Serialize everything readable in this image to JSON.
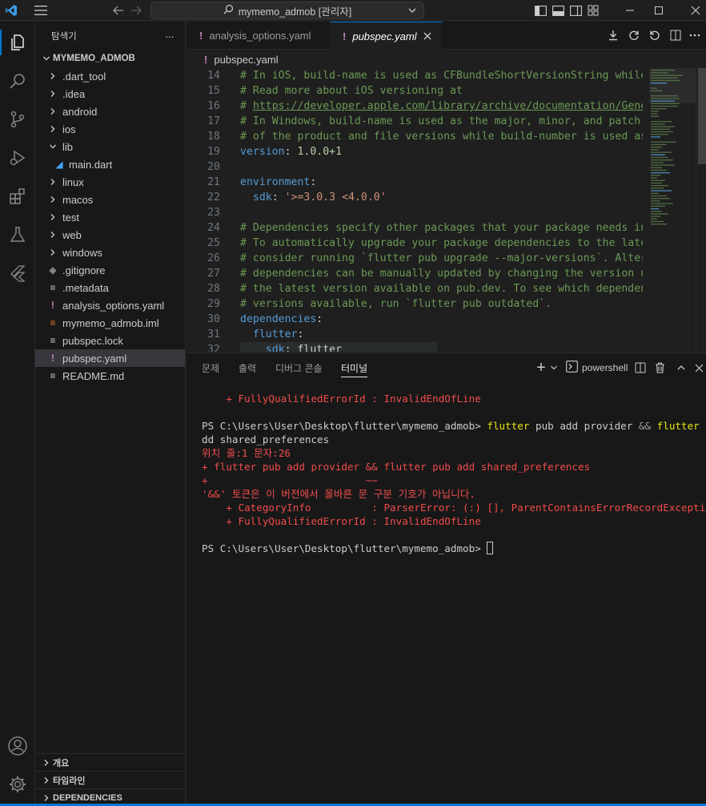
{
  "titlebar": {
    "search_label": "mymemo_admob [관리자]"
  },
  "explorer": {
    "title": "탐색기",
    "more": "···",
    "root": "MYMEMO_ADMOB",
    "items": [
      {
        "label": ".dart_tool",
        "type": "folder"
      },
      {
        "label": ".idea",
        "type": "folder"
      },
      {
        "label": "android",
        "type": "folder"
      },
      {
        "label": "ios",
        "type": "folder"
      },
      {
        "label": "lib",
        "type": "folder-open"
      },
      {
        "label": "main.dart",
        "type": "dart"
      },
      {
        "label": "linux",
        "type": "folder"
      },
      {
        "label": "macos",
        "type": "folder"
      },
      {
        "label": "test",
        "type": "folder"
      },
      {
        "label": "web",
        "type": "folder"
      },
      {
        "label": "windows",
        "type": "folder"
      },
      {
        "label": ".gitignore",
        "type": "git"
      },
      {
        "label": ".metadata",
        "type": "text"
      },
      {
        "label": "analysis_options.yaml",
        "type": "yaml"
      },
      {
        "label": "mymemo_admob.iml",
        "type": "iml"
      },
      {
        "label": "pubspec.lock",
        "type": "text"
      },
      {
        "label": "pubspec.yaml",
        "type": "yaml",
        "selected": true
      },
      {
        "label": "README.md",
        "type": "text"
      }
    ],
    "bottom_panels": [
      "개요",
      "타임라인",
      "DEPENDENCIES"
    ]
  },
  "tabs": [
    {
      "label": "analysis_options.yaml",
      "active": false
    },
    {
      "label": "pubspec.yaml",
      "active": true
    }
  ],
  "breadcrumb": "pubspec.yaml",
  "code_lines": [
    {
      "n": "14",
      "parts": [
        {
          "c": "com",
          "t": "# In iOS, build-name is used as CFBundleShortVersionString while b"
        }
      ]
    },
    {
      "n": "15",
      "parts": [
        {
          "c": "com",
          "t": "# Read more about iOS versioning at"
        }
      ]
    },
    {
      "n": "16",
      "parts": [
        {
          "c": "com",
          "t": "# "
        },
        {
          "c": "link",
          "t": "https://developer.apple.com/library/archive/documentation/Genera"
        }
      ]
    },
    {
      "n": "17",
      "parts": [
        {
          "c": "com",
          "t": "# In Windows, build-name is used as the major, minor, and patch pa"
        }
      ]
    },
    {
      "n": "18",
      "parts": [
        {
          "c": "com",
          "t": "# of the product and file versions while build-number is used as t"
        }
      ]
    },
    {
      "n": "19",
      "parts": [
        {
          "c": "key",
          "t": "version"
        },
        {
          "c": "plain",
          "t": ": "
        },
        {
          "c": "num",
          "t": "1.0.0+1"
        }
      ]
    },
    {
      "n": "20",
      "parts": []
    },
    {
      "n": "21",
      "parts": [
        {
          "c": "key",
          "t": "environment"
        },
        {
          "c": "plain",
          "t": ":"
        }
      ]
    },
    {
      "n": "22",
      "parts": [
        {
          "c": "plain",
          "t": "  "
        },
        {
          "c": "key",
          "t": "sdk"
        },
        {
          "c": "plain",
          "t": ": "
        },
        {
          "c": "str",
          "t": "'>=3.0.3 <4.0.0'"
        }
      ]
    },
    {
      "n": "23",
      "parts": []
    },
    {
      "n": "24",
      "parts": [
        {
          "c": "com",
          "t": "# Dependencies specify other packages that your package needs in o"
        }
      ]
    },
    {
      "n": "25",
      "parts": [
        {
          "c": "com",
          "t": "# To automatically upgrade your package dependencies to the latest"
        }
      ]
    },
    {
      "n": "26",
      "parts": [
        {
          "c": "com",
          "t": "# consider running `flutter pub upgrade --major-versions`. Alterna"
        }
      ]
    },
    {
      "n": "27",
      "parts": [
        {
          "c": "com",
          "t": "# dependencies can be manually updated by changing the version num"
        }
      ]
    },
    {
      "n": "28",
      "parts": [
        {
          "c": "com",
          "t": "# the latest version available on pub.dev. To see which dependenci"
        }
      ]
    },
    {
      "n": "29",
      "parts": [
        {
          "c": "com",
          "t": "# versions available, run `flutter pub outdated`."
        }
      ]
    },
    {
      "n": "30",
      "parts": [
        {
          "c": "key",
          "t": "dependencies"
        },
        {
          "c": "plain",
          "t": ":"
        }
      ]
    },
    {
      "n": "31",
      "parts": [
        {
          "c": "plain",
          "t": "  "
        },
        {
          "c": "key",
          "t": "flutter"
        },
        {
          "c": "plain",
          "t": ":"
        }
      ]
    },
    {
      "n": "32",
      "parts": [
        {
          "c": "plain",
          "t": "    "
        },
        {
          "c": "key",
          "t": "sdk"
        },
        {
          "c": "plain",
          "t": ": flutter"
        }
      ]
    }
  ],
  "panel": {
    "tabs": [
      "문제",
      "출력",
      "디버그 콘솔",
      "터미널"
    ],
    "active_tab": "터미널",
    "shell": "powershell",
    "plus": "+",
    "terminal_lines": [
      [
        {
          "c": "red",
          "t": "    + FullyQualifiedErrorId : InvalidEndOfLine"
        }
      ],
      [],
      [
        {
          "c": "white",
          "t": "PS C:\\Users\\User\\Desktop\\flutter\\mymemo_admob> "
        },
        {
          "c": "yellow",
          "t": "flutter"
        },
        {
          "c": "white",
          "t": " pub add provider "
        },
        {
          "c": "gray",
          "t": "&&"
        },
        {
          "c": "white",
          "t": " "
        },
        {
          "c": "yellow",
          "t": "flutter"
        },
        {
          "c": "white",
          "t": " pub a"
        }
      ],
      [
        {
          "c": "white",
          "t": "dd shared_preferences"
        }
      ],
      [
        {
          "c": "red",
          "t": "위치 줄:1 문자:26"
        }
      ],
      [
        {
          "c": "red",
          "t": "+ flutter pub add provider && flutter pub add shared_preferences"
        }
      ],
      [
        {
          "c": "red",
          "t": "+                          ~~"
        }
      ],
      [
        {
          "c": "red",
          "t": "'&&' 토큰은 이 버전에서 올바른 문 구분 기호가 아닙니다."
        }
      ],
      [
        {
          "c": "red",
          "t": "    + CategoryInfo          : ParserError: (:) [], ParentContainsErrorRecordException"
        }
      ],
      [
        {
          "c": "red",
          "t": "    + FullyQualifiedErrorId : InvalidEndOfLine"
        }
      ],
      [],
      [
        {
          "c": "white",
          "t": "PS C:\\Users\\User\\Desktop\\flutter\\mymemo_admob> "
        }
      ]
    ]
  },
  "colors": {
    "accent": "#0078d4",
    "error": "#f14c4c",
    "command": "#e5e510"
  }
}
